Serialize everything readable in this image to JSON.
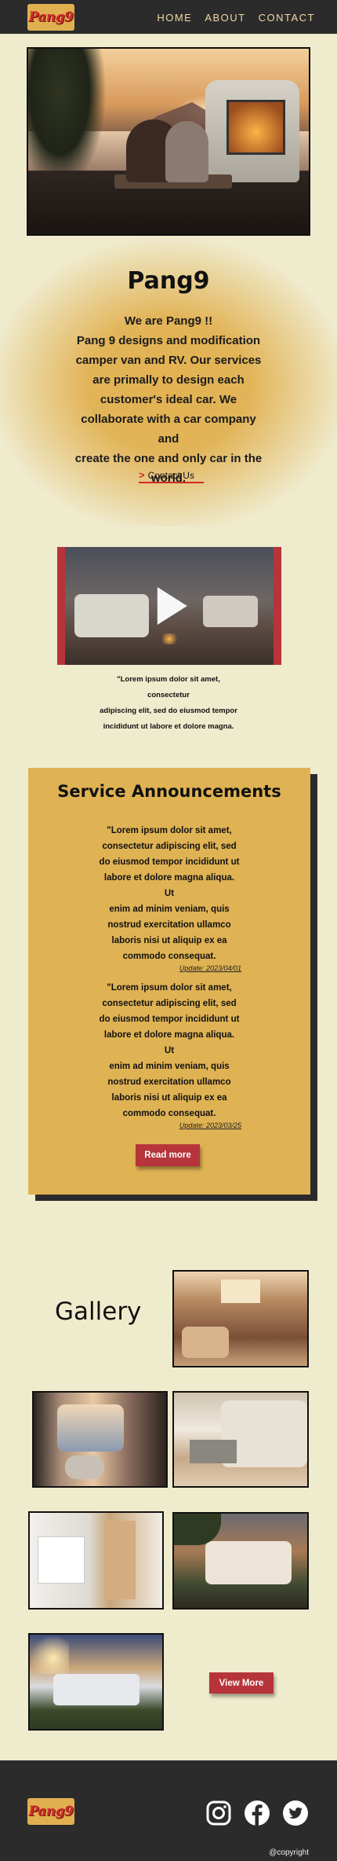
{
  "header": {
    "logo_text": "Pang9",
    "nav": [
      "HOME",
      "ABOUT",
      "CONTACT"
    ]
  },
  "about": {
    "title": "Pang9",
    "lines": [
      "We are Pang9 !!",
      "Pang 9 designs and modification",
      "camper van and RV. Our services",
      "are primally to design each",
      "customer's ideal car. We",
      "collaborate with a car company and",
      "create the one and only car in the",
      "world."
    ],
    "contact_label": "Contact Us"
  },
  "video": {
    "caption_lines": [
      "\"Lorem ipsum dolor sit amet, consectetur",
      "adipiscing elit, sed do eiusmod tempor",
      "incididunt ut labore et dolore magna."
    ]
  },
  "announcements": {
    "title": "Service Announcements",
    "items": [
      {
        "lines": [
          "\"Lorem ipsum dolor sit amet,",
          "consectetur adipiscing elit, sed",
          "do eiusmod tempor incididunt ut",
          "labore et dolore magna aliqua. Ut",
          "enim ad minim veniam, quis",
          "nostrud exercitation ullamco",
          "laboris nisi ut aliquip ex ea",
          "commodo consequat."
        ],
        "date": "Update: 2023/04/01"
      },
      {
        "lines": [
          "\"Lorem ipsum dolor sit amet,",
          "consectetur adipiscing elit, sed",
          "do eiusmod tempor incididunt ut",
          "labore et dolore magna aliqua. Ut",
          "enim ad minim veniam, quis",
          "nostrud exercitation ullamco",
          "laboris nisi ut aliquip ex ea",
          "commodo consequat."
        ],
        "date": "Update: 2023/03/25"
      }
    ],
    "read_more_label": "Read more"
  },
  "gallery": {
    "title": "Gallery",
    "view_more_label": "View More"
  },
  "footer": {
    "logo_text": "Pang9",
    "copyright": "@copyright",
    "social_icons": [
      "instagram-icon",
      "facebook-icon",
      "twitter-icon"
    ]
  },
  "colors": {
    "page_bg": "#efebcd",
    "header_bg": "#2b2b2b",
    "accent_gold": "#dfb253",
    "accent_red": "#b6343a",
    "nav_text": "#f2d9a6"
  }
}
